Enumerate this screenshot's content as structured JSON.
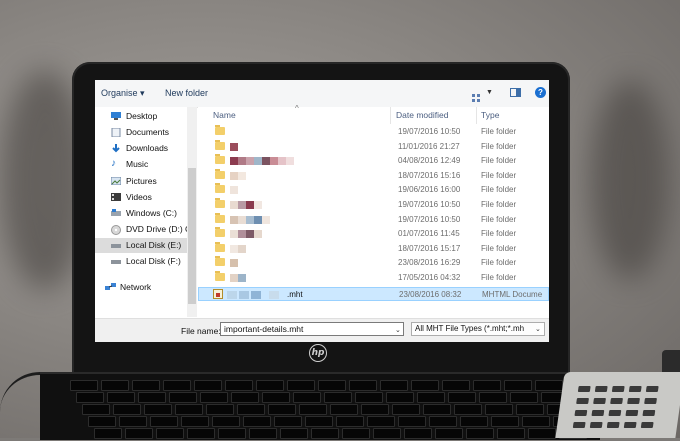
{
  "toolbar": {
    "organise_label": "Organise ▾",
    "new_folder_label": "New folder"
  },
  "nav": {
    "items": [
      {
        "label": "Desktop",
        "icon": "desktop-icon"
      },
      {
        "label": "Documents",
        "icon": "documents-icon"
      },
      {
        "label": "Downloads",
        "icon": "downloads-icon"
      },
      {
        "label": "Music",
        "icon": "music-icon"
      },
      {
        "label": "Pictures",
        "icon": "pictures-icon"
      },
      {
        "label": "Videos",
        "icon": "videos-icon"
      },
      {
        "label": "Windows (C:)",
        "icon": "drive-icon"
      },
      {
        "label": "DVD Drive (D:) C",
        "icon": "dvd-icon"
      },
      {
        "label": "Local Disk (E:)",
        "icon": "drive-icon",
        "selected": true
      },
      {
        "label": "Local Disk (F:)",
        "icon": "drive-icon"
      },
      {
        "label": "Network",
        "icon": "network-icon"
      }
    ]
  },
  "list": {
    "columns": {
      "name": "Name",
      "date": "Date modified",
      "type": "Type"
    },
    "rows": [
      {
        "date": "19/07/2016 10:50",
        "type": "File folder",
        "blur": []
      },
      {
        "date": "11/01/2016 21:27",
        "type": "File folder",
        "blur": [
          "#9b4d5c"
        ]
      },
      {
        "date": "04/08/2016 12:49",
        "type": "File folder",
        "blur": [
          "#8c3b4f",
          "#b07a86",
          "#caa2ab",
          "#9fb6c9",
          "#7b5360",
          "#c98c95",
          "#e5c3c8",
          "#f0dede"
        ]
      },
      {
        "date": "18/07/2016 15:16",
        "type": "File folder",
        "blur": [
          "#e6d2c3",
          "#f3e8df"
        ]
      },
      {
        "date": "19/06/2016 16:00",
        "type": "File folder",
        "blur": [
          "#efe4dc"
        ]
      },
      {
        "date": "19/07/2016 10:50",
        "type": "File folder",
        "blur": [
          "#e8dad0",
          "#b89aa4",
          "#8a3a4e",
          "#f1e7e1"
        ]
      },
      {
        "date": "19/07/2016 10:50",
        "type": "File folder",
        "blur": [
          "#d7c3b3",
          "#e9ddd4",
          "#a8bdd0",
          "#6e8fb1",
          "#f0e6df"
        ]
      },
      {
        "date": "01/07/2016 11:45",
        "type": "File folder",
        "blur": [
          "#eadfd6",
          "#b08f9a",
          "#7d5a66",
          "#e6d8cd"
        ]
      },
      {
        "date": "18/07/2016 15:17",
        "type": "File folder",
        "blur": [
          "#f1e8e1",
          "#e3d5ca"
        ]
      },
      {
        "date": "23/08/2016 16:29",
        "type": "File folder",
        "blur": [
          "#d6c0ac"
        ]
      },
      {
        "date": "17/05/2016 04:32",
        "type": "File folder",
        "blur": [
          "#e2d2c5",
          "#9cb4c9"
        ]
      }
    ],
    "selected_row": {
      "name_suffix": ".mht",
      "date": "23/08/2016 08:32",
      "type": "MHTML Docume",
      "blur": [
        "#bcd6ea",
        "#a9c8e3",
        "#8fb4d6",
        "#c8dcec"
      ]
    }
  },
  "bottom": {
    "file_name_label": "File name:",
    "file_name_value": "important-details.mht",
    "file_type_value": "All MHT File Types (*.mht;*.mh"
  },
  "device": {
    "logo": "hp"
  }
}
